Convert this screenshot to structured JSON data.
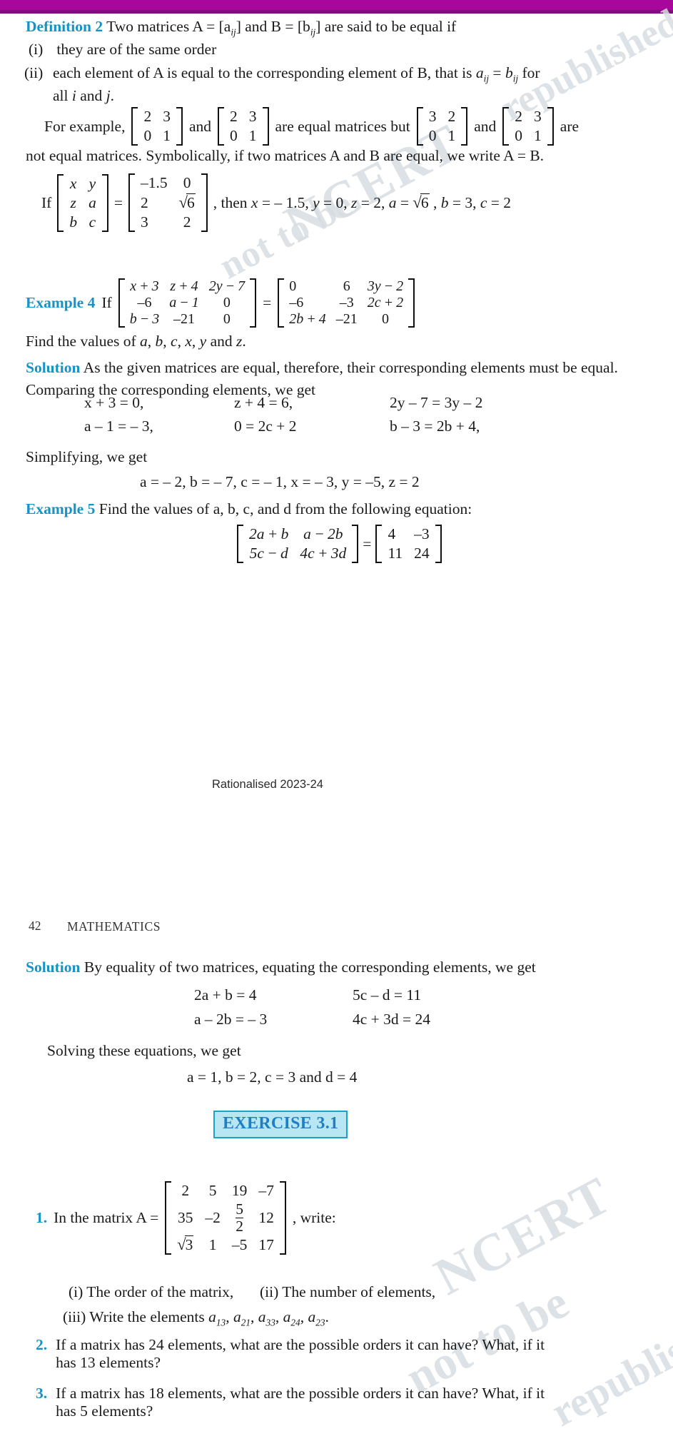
{
  "page": {
    "number": "42",
    "running_head": "MATHEMATICS",
    "footer": "Rationalised 2023-24",
    "watermark_lines": [
      "NCERT",
      "not to be",
      "republished",
      "NCERT",
      "not to be",
      "republished"
    ],
    "accent_heading_color": "#1593c4",
    "topbar_color": "#a8079c",
    "exercise_box_fill": "#b8e6f2",
    "exercise_box_border": "#1aa3c8"
  },
  "definition": {
    "label": "Definition 2",
    "lead": "Two matrices A = [a",
    "lead_sub1": "ij",
    "lead_mid": "] and B = [b",
    "lead_sub2": "ij",
    "lead_end": "] are said to be equal if",
    "items": [
      {
        "marker": "(i)",
        "text": "they are of the same order"
      },
      {
        "marker": "(ii)",
        "text_a": "each element of A is equal to the corresponding element of B, that is ",
        "text_b": " = ",
        "text_c": " for",
        "line2_a": "all ",
        "line2_i": "i",
        "line2_b": " and ",
        "line2_j": "j",
        "line2_c": "."
      }
    ]
  },
  "example_intro": {
    "for_example": "For example,",
    "and_1": "and",
    "are_equal": "are equal matrices but",
    "and_2": "and",
    "are": "are",
    "closing": "not equal matrices. Symbolically, if two matrices A and B are equal, we write A = B.",
    "matrix_1": [
      [
        "2",
        "3"
      ],
      [
        "0",
        "1"
      ]
    ],
    "matrix_2": [
      [
        "2",
        "3"
      ],
      [
        "0",
        "1"
      ]
    ],
    "matrix_3": [
      [
        "3",
        "2"
      ],
      [
        "0",
        "1"
      ]
    ],
    "matrix_4": [
      [
        "2",
        "3"
      ],
      [
        "0",
        "1"
      ]
    ]
  },
  "equality_example": {
    "if_label": "If",
    "lhs": [
      [
        "x",
        "y"
      ],
      [
        "z",
        "a"
      ],
      [
        "b",
        "c"
      ]
    ],
    "eq": "=",
    "rhs": [
      [
        "–1.5",
        "0"
      ],
      [
        "2",
        "√6"
      ],
      [
        "3",
        "2"
      ]
    ],
    "then_text": ", then x = – 1.5, y = 0, z = 2, a = √6 , b = 3, c = 2"
  },
  "example4": {
    "label": "Example 4",
    "if_word": "If",
    "lhs": [
      [
        "x + 3",
        "z + 4",
        "2y – 7"
      ],
      [
        "–6",
        "a – 1",
        "0"
      ],
      [
        "b – 3",
        "–21",
        "0"
      ]
    ],
    "eq": "=",
    "rhs": [
      [
        "0",
        "6",
        "3y – 2"
      ],
      [
        "–6",
        "–3",
        "2c + 2"
      ],
      [
        "2b + 4",
        "–21",
        "0"
      ]
    ],
    "find": "Find the values of a, b, c, x, y and z.",
    "solution_label": "Solution",
    "solution_text": "As the given matrices are equal, therefore, their corresponding elements must be equal. Comparing the corresponding elements, we get",
    "equations": [
      [
        "x + 3 = 0,",
        "z + 4 = 6,",
        "2y – 7 = 3y – 2"
      ],
      [
        "a – 1 = – 3,",
        "0 = 2c + 2",
        "b – 3 = 2b + 4,"
      ]
    ],
    "simplifying": "Simplifying, we get",
    "answers": "a = – 2, b = – 7, c = – 1, x = – 3, y = –5, z = 2"
  },
  "example5": {
    "label": "Example 5",
    "prompt": "Find the values of a, b, c, and d from the following equation:",
    "lhs": [
      [
        "2a + b",
        "a – 2b"
      ],
      [
        "5c – d",
        "4c + 3d"
      ]
    ],
    "eq": "=",
    "rhs": [
      [
        "4",
        "–3"
      ],
      [
        "11",
        "24"
      ]
    ],
    "solution_label": "Solution",
    "solution_text": "By equality of two matrices, equating the corresponding elements, we get",
    "equations": [
      [
        "2a + b = 4",
        "5c – d = 11"
      ],
      [
        "a – 2b = – 3",
        "4c + 3d = 24"
      ]
    ],
    "solving": "Solving these equations, we get",
    "answers": "a = 1, b = 2, c = 3 and d = 4"
  },
  "exercise": {
    "title": "EXERCISE 3.1",
    "q1": {
      "marker": "1.",
      "lead": "In the matrix  A =",
      "matrix": [
        [
          "2",
          "5",
          "19",
          "–7"
        ],
        [
          "35",
          "–2",
          "5/2",
          "12"
        ],
        [
          "√3",
          "1",
          "–5",
          "17"
        ]
      ],
      "tail": ", write:",
      "sub_i": "(i)  The order of the matrix,",
      "sub_ii": "(ii)  The number of elements,",
      "sub_iii_lead": "(iii)  Write the elements ",
      "sub_iii_elements": [
        "13",
        "21",
        "33",
        "24",
        "23"
      ]
    },
    "q2": {
      "marker": "2.",
      "line1": "If a matrix has 24 elements, what are the possible orders it can have? What, if it",
      "line2": "has 13 elements?"
    },
    "q3": {
      "marker": "3.",
      "line1": "If a matrix has 18 elements, what are the possible orders it can have? What, if it",
      "line2": "has 5 elements?"
    }
  }
}
